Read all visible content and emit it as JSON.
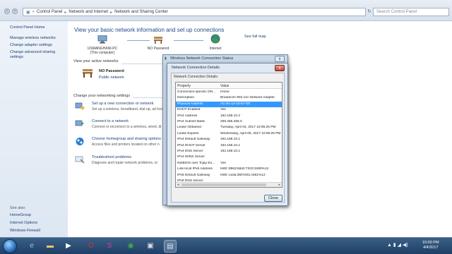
{
  "address_bar": {
    "crumbs": [
      "Control Panel",
      "Network and Internet",
      "Network and Sharing Center"
    ],
    "search_placeholder": "Search Control Panel"
  },
  "left_pane": {
    "links": [
      "Control Panel Home",
      "Manage wireless networks",
      "Change adapter settings",
      "Change advanced sharing",
      "settings"
    ],
    "see_also_label": "See also",
    "see_also_links": [
      "HomeGroup",
      "Internet Options",
      "Windows Firewall"
    ]
  },
  "main": {
    "title": "View your basic network information and set up connections",
    "see_full_map": "See full map",
    "map": [
      {
        "label": "USMANGHANI-PC",
        "sub": "(This computer)"
      },
      {
        "label": "NO Password",
        "sub": ""
      },
      {
        "label": "Internet",
        "sub": ""
      }
    ],
    "active_networks_heading": "View your active networks",
    "active_network": {
      "name": "NO Password",
      "type": "Public network"
    },
    "change_settings_heading": "Change your networking settings",
    "tasks": [
      {
        "link": "Set up a new connection or network",
        "desc": "Set up a wireless, broadband, dial-up, ad hoc"
      },
      {
        "link": "Connect to a network",
        "desc": "Connect or reconnect to a wireless, wired, di"
      },
      {
        "link": "Choose homegroup and sharing options",
        "desc": "Access files and printers located on other n"
      },
      {
        "link": "Troubleshoot problems",
        "desc": "Diagnose and repair network problems, or"
      }
    ]
  },
  "status_window": {
    "title": "Wireless Network Connection Status",
    "close": "x"
  },
  "details_dialog": {
    "title": "Network Connection Details",
    "close": "x",
    "group_label": "Network Connection Details:",
    "columns": [
      "Property",
      "Value"
    ],
    "rows": [
      {
        "property": "Connection-specific DN...",
        "value": "Home"
      },
      {
        "property": "Description",
        "value": "Broadcom 802.11n Network Adapter"
      },
      {
        "property": "Physical Address",
        "value": "AC-81-12-43-57-D0"
      },
      {
        "property": "DHCP Enabled",
        "value": "Yes"
      },
      {
        "property": "IPv4 Address",
        "value": "192.168.10.2"
      },
      {
        "property": "IPv4 Subnet Mask",
        "value": "255.255.255.0"
      },
      {
        "property": "Lease Obtained",
        "value": "Tuesday, April 04, 2017 10:05:25 PM"
      },
      {
        "property": "Lease Expires",
        "value": "Wednesday, April 05, 2017 10:05:25 PM"
      },
      {
        "property": "IPv4 Default Gateway",
        "value": "192.168.10.1"
      },
      {
        "property": "IPv4 DHCP Server",
        "value": "192.168.10.1"
      },
      {
        "property": "IPv4 DNS Server",
        "value": "192.168.10.1"
      },
      {
        "property": "IPv4 WINS Server",
        "value": ""
      },
      {
        "property": "NetBIOS over Tcpip En...",
        "value": "Yes"
      },
      {
        "property": "Link-local IPv6 Address",
        "value": "fe80::8963:8dd2:7203:3480%12"
      },
      {
        "property": "IPv6 Default Gateway",
        "value": "fe80::ca3a:35ff:fe51:c681%12"
      },
      {
        "property": "IPv6 DNS Server",
        "value": ""
      }
    ],
    "selected_row": 2,
    "close_button": "Close"
  },
  "taskbar": {
    "clock_time": "10:00 PM",
    "clock_date": "4/4/2017",
    "tray": "▲ ▮ ◢ ◀)"
  },
  "colors": {
    "link": "#1b3e78",
    "title": "#1e4c8a",
    "selection": "#3399ff",
    "taskbar": "#1f3f66"
  }
}
